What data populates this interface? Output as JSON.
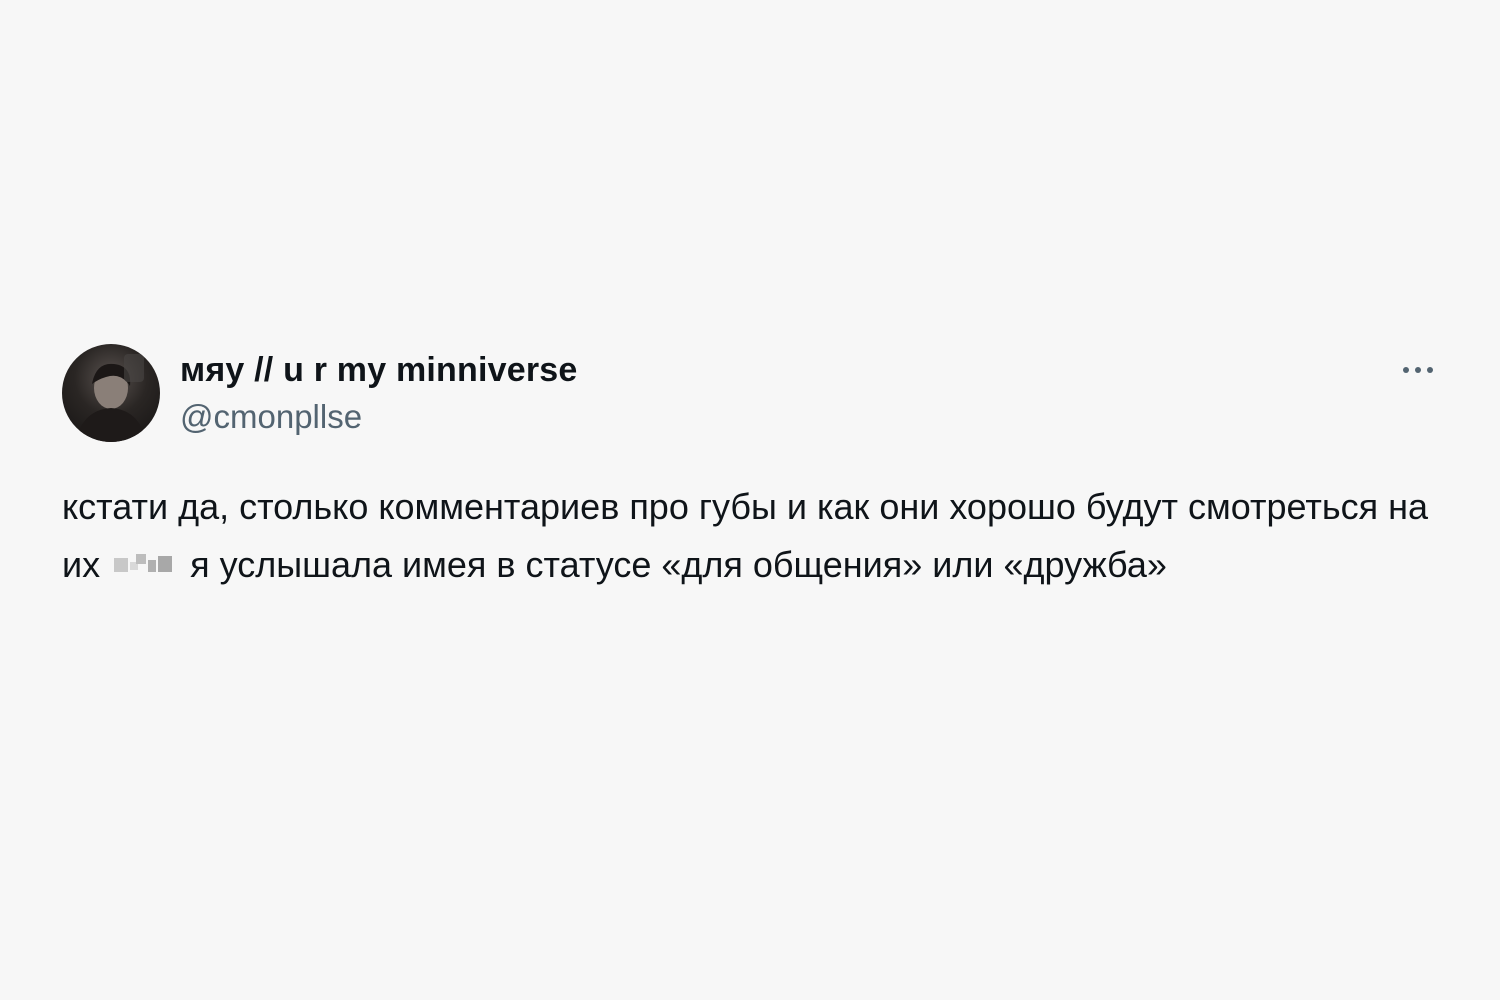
{
  "tweet": {
    "display_name": "мяу // u r my minniverse",
    "handle": "@cmonpllse",
    "more_label": "More options",
    "text_part1": "кстати да, столько комментариев про губы и как они хорошо будут смотреться на их",
    "text_part2": "я услышала имея в статусе «для общения» или «дружба»",
    "avatar_icon": "user-avatar-photo",
    "more_icon": "more-dots-icon",
    "censor_icon": "pixelated-censor-block"
  },
  "colors": {
    "background": "#f7f7f7",
    "text_primary": "#0f1419",
    "text_secondary": "#536471"
  }
}
